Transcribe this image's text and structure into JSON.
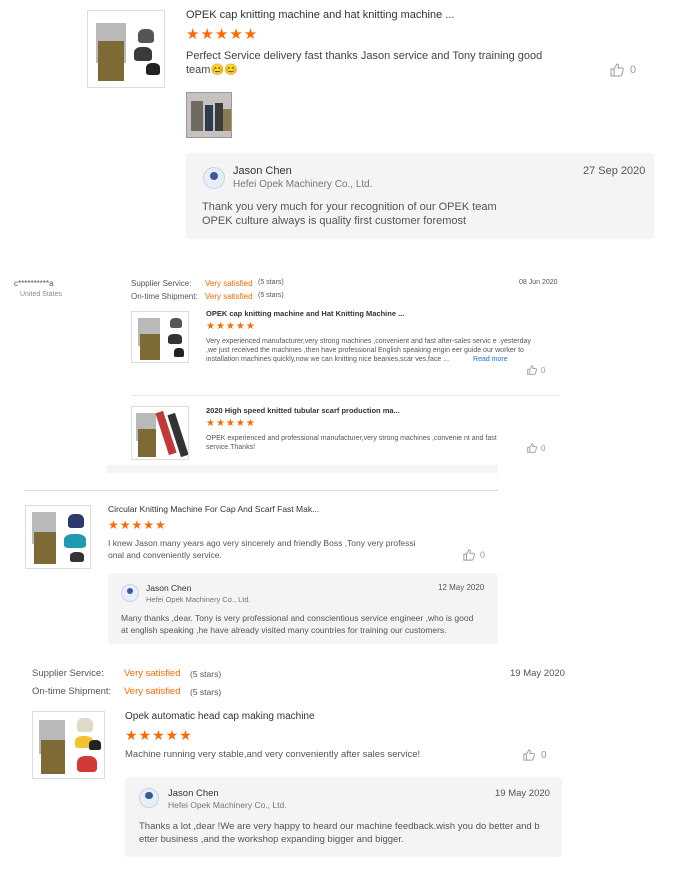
{
  "colors": {
    "star": "#ff6a00",
    "satisfied": "#ff6a00",
    "link": "#1a73e8",
    "reply_bg": "#f4f4f4"
  },
  "review1": {
    "product_title": "OPEK cap knitting machine and hat knitting machine ...",
    "stars": "★★★★★",
    "comment": "Perfect Service delivery fast thanks Jason service and Tony training good team😊😊",
    "like_count": "0",
    "reply": {
      "name": "Jason Chen",
      "company": "Hefei Opek Machinery Co., Ltd.",
      "date": "27 Sep 2020",
      "line1": "Thank you very much for your recognition of our OPEK team",
      "line2": "OPEK  culture always is quality first  customer foremost"
    }
  },
  "review2": {
    "buyer": "c**********a",
    "country": "United States",
    "supplier_label": "Supplier Service:",
    "supplier_value": "Very satisfied",
    "supplier_stars": "(5 stars)",
    "shipment_label": "On-time Shipment:",
    "shipment_value": "Very satisfied",
    "shipment_stars": "(5 stars)",
    "date": "08 Jun 2020",
    "items": [
      {
        "title": "OPEK cap knitting machine and Hat Knitting Machine ...",
        "stars": "★★★★★",
        "comment": "Very experienced manufacturer,very strong machines ,convenient and fast after-sales servic e .yesterday ,we just received the machines ,then have professional English speaking engin eer guide our worker to installation machines quickly,now we can knitting nice beanies,scar ves,face ...",
        "read_more": "Read more",
        "like_count": "0"
      },
      {
        "title": "2020 High speed knitted tubular scarf production ma...",
        "stars": "★★★★★",
        "comment": "OPEK experienced and professional manufacturer,very strong machines ,convenie nt and fast service.Thanks!",
        "like_count": "0"
      }
    ]
  },
  "review3": {
    "product_title": "Circular Knitting Machine For Cap And Scarf Fast Mak...",
    "stars": "★★★★★",
    "comment": "I knew Jason many years ago very sincerely and friendly Boss ,Tony very professi onal and conveniently service.",
    "like_count": "0",
    "reply": {
      "name": "Jason Chen",
      "company": "Hefei Opek Machinery Co., Ltd.",
      "date": "12 May 2020",
      "text": "Many thanks ,dear. Tony is very professional and conscientious service engineer ,who is good at english speaking ,he have already visited many countries for training our customers."
    }
  },
  "review4": {
    "supplier_label": "Supplier Service:",
    "supplier_value": "Very satisfied",
    "supplier_stars": "(5 stars)",
    "shipment_label": "On-time Shipment:",
    "shipment_value": "Very satisfied",
    "shipment_stars": "(5 stars)",
    "date": "19 May 2020",
    "product_title": "Opek automatic head cap making machine",
    "stars": "★★★★★",
    "comment": "Machine running very stable,and very conveniently after sales service!",
    "like_count": "0",
    "reply": {
      "name": "Jason Chen",
      "company": "Hefei Opek Machinery Co., Ltd.",
      "date": "19 May 2020",
      "text": "Thanks a lot ,dear !We are very happy to heard our machine feedback.wish you do better and b etter business ,and the workshop expanding bigger and bigger."
    }
  }
}
